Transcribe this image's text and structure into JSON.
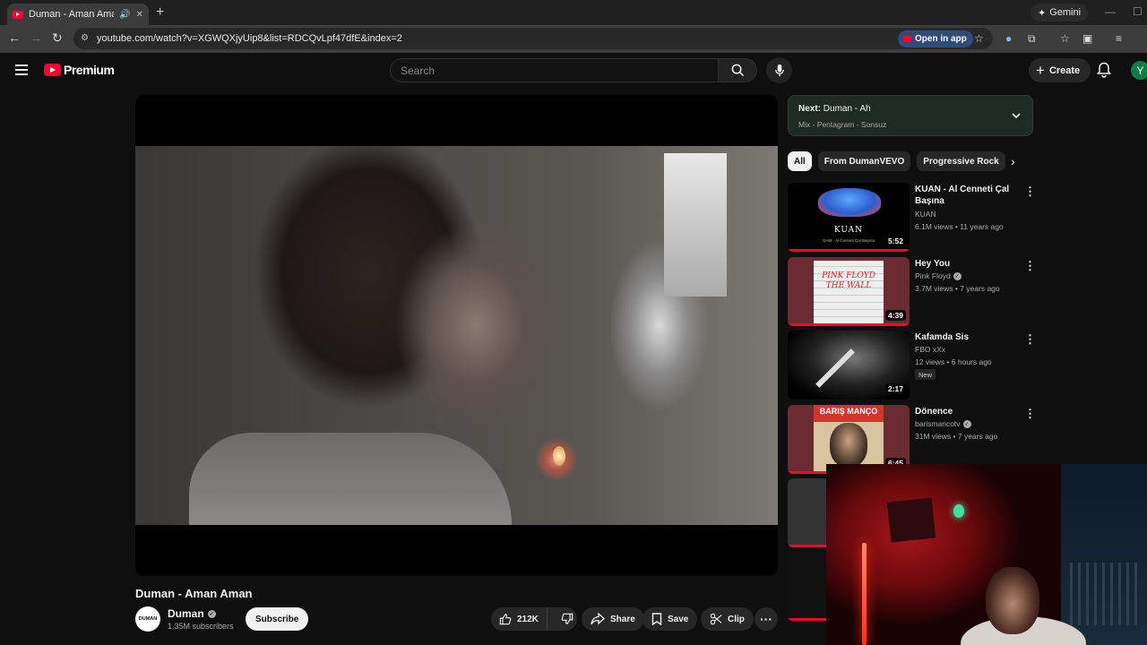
{
  "browser": {
    "tab_title": "Duman - Aman Aman - YouTube",
    "url": "youtube.com/watch?v=XGWQXjyUip8&list=RDCQvLpf47dfE&index=2",
    "gemini_label": "Gemini",
    "open_in_app_label": "Open in app"
  },
  "header": {
    "logo_text": "Premium",
    "search_placeholder": "Search",
    "create_label": "Create",
    "avatar_letter": "Y"
  },
  "video": {
    "title": "Duman - Aman Aman",
    "channel": {
      "name": "Duman",
      "avatar_text": "DUMAN",
      "subscribers": "1.35M subscribers",
      "subscribe_label": "Subscribe"
    },
    "actions": {
      "likes": "212K",
      "share_label": "Share",
      "save_label": "Save",
      "clip_label": "Clip"
    }
  },
  "sidebar": {
    "next": {
      "prefix": "Next:",
      "title": "Duman - Ah",
      "mix": "Mix - Pentagram - Sonsuz"
    },
    "chips": [
      "All",
      "From DumanVEVO",
      "Progressive Rock"
    ],
    "items": [
      {
        "title": "KUAN - Al Cenneti Çal Başına",
        "channel": "KUAN",
        "meta": "6.1M views • 11 years ago",
        "duration": "5:52",
        "verified": false,
        "badge": "",
        "thumb_text": "KUAN",
        "thumb_sub": "GAM - Al Cenneti Çal Başına"
      },
      {
        "title": "Hey You",
        "channel": "Pink Floyd",
        "meta": "3.7M views • 7 years ago",
        "duration": "4:39",
        "verified": true,
        "badge": "",
        "thumb_text": "PINK FLOYD THE WALL"
      },
      {
        "title": "Kafamda Sis",
        "channel": "FBO xXx",
        "meta": "12 views • 6 hours ago",
        "duration": "2:17",
        "verified": false,
        "badge": "New"
      },
      {
        "title": "Dönence",
        "channel": "barismancotv",
        "meta": "31M views • 7 years ago",
        "duration": "6:45",
        "verified": true,
        "badge": "",
        "thumb_text": "BARIŞ MANÇO"
      }
    ]
  },
  "colors": {
    "background": "#0f0f0f",
    "accent_red": "#ff0033",
    "next_box": "#1e2a24"
  }
}
